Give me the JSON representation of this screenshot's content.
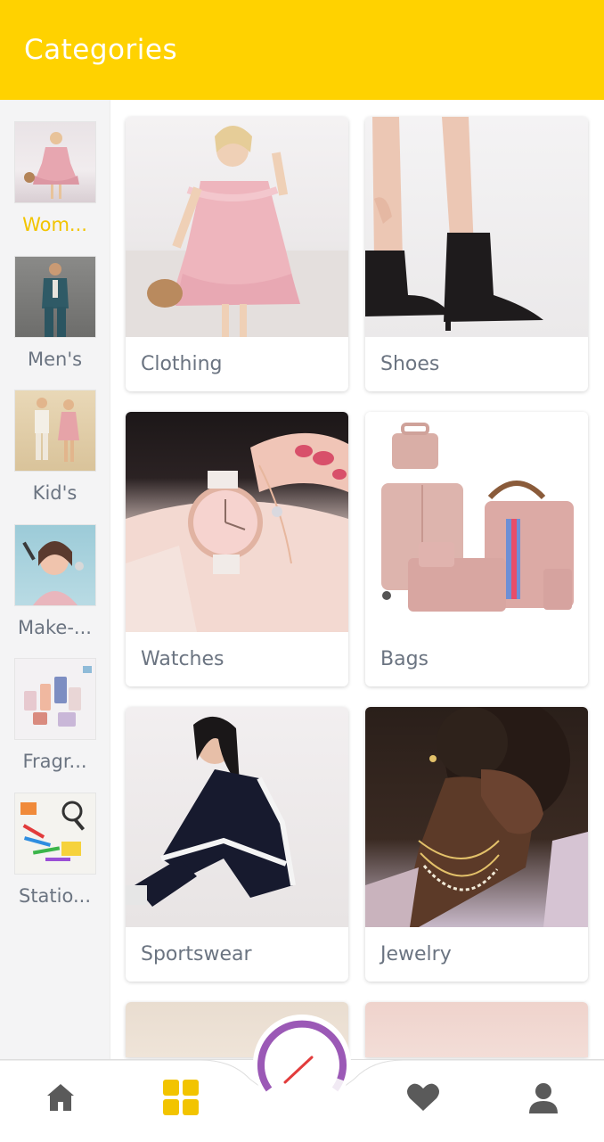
{
  "header": {
    "title": "Categories"
  },
  "sidebar": {
    "items": [
      {
        "label": "Wom...",
        "active": true
      },
      {
        "label": "Men's"
      },
      {
        "label": "Kid's"
      },
      {
        "label": "Make-..."
      },
      {
        "label": "Fragr..."
      },
      {
        "label": "Statio..."
      }
    ]
  },
  "grid": {
    "items": [
      {
        "label": "Clothing"
      },
      {
        "label": "Shoes"
      },
      {
        "label": "Watches"
      },
      {
        "label": "Bags"
      },
      {
        "label": "Sportswear"
      },
      {
        "label": "Jewelry"
      }
    ]
  },
  "nav": {
    "items": [
      {
        "icon": "home-icon"
      },
      {
        "icon": "grid-icon",
        "active": true
      },
      {
        "icon": "speedometer-icon"
      },
      {
        "icon": "heart-icon"
      },
      {
        "icon": "person-icon"
      }
    ]
  },
  "colors": {
    "accent": "#FFD200",
    "active_label": "#F2C400",
    "text_muted": "#6b7481",
    "fab_arc": "#9b59b6"
  }
}
